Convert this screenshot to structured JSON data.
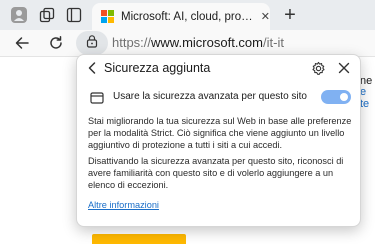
{
  "tab": {
    "title": "Microsoft: AI, cloud, produttività, computer, app",
    "close_glyph": "✕"
  },
  "new_tab_glyph": "+",
  "address_bar": {
    "protocol": "https://",
    "host": "www.microsoft.com",
    "path": "/it-it"
  },
  "popup": {
    "title": "Sicurezza aggiunta",
    "toggle_label": "Usare la sicurezza avanzata per questo sito",
    "toggle_on": true,
    "paragraph1": "Stai migliorando la tua sicurezza sul Web in base alle preferenze per la modalità Strict. Ciò significa che viene aggiunto un livello aggiuntivo di protezione a tutti i siti a cui accedi.",
    "paragraph2": "Disattivando la sicurezza avanzata per questo sito, riconosci di avere familiarità con questo sito e di volerlo aggiungere a un elenco di eccezioni.",
    "more_link": "Altre informazioni"
  },
  "side_fragments": [
    "ne",
    "e",
    "te"
  ],
  "icons": [
    "edge-profile-icon",
    "workspaces-icon",
    "tab-actions-icon",
    "microsoft-logo-icon",
    "back-arrow-icon",
    "refresh-icon",
    "lock-icon",
    "chevron-left-icon",
    "gear-icon",
    "close-icon",
    "browser-window-icon"
  ],
  "colors": {
    "toggle_on": "#1a73e8",
    "link": "#1a6ec8",
    "ms_red": "#f25022",
    "ms_green": "#7fba00",
    "ms_blue": "#00a4ef",
    "ms_yellow": "#ffb900"
  }
}
